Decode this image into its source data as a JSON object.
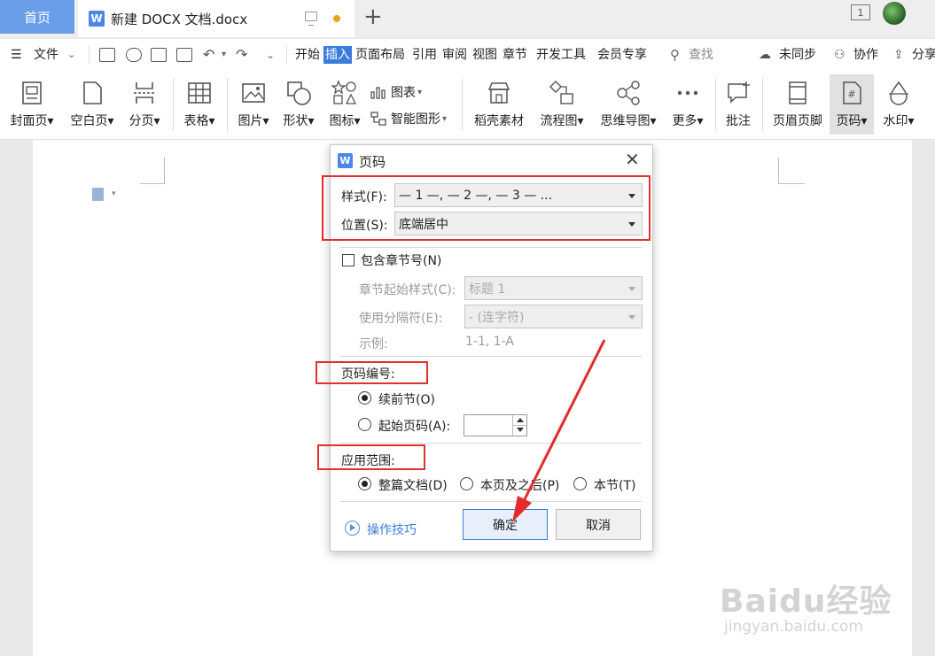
{
  "tabs": {
    "home": "首页",
    "doc_title": "新建 DOCX 文档.docx",
    "add": "+",
    "badge": "1"
  },
  "menubar": {
    "file": "文件",
    "items": [
      "开始",
      "插入",
      "页面布局",
      "引用",
      "审阅",
      "视图",
      "章节",
      "开发工具",
      "会员专享"
    ],
    "search": "查找",
    "sync": "未同步",
    "collab": "协作",
    "share": "分享"
  },
  "ribbon": {
    "cover": "封面页",
    "blank": "空白页",
    "break": "分页",
    "table": "表格",
    "picture": "图片",
    "shape": "形状",
    "icon": "图标",
    "chart": "图表",
    "smartart": "智能图形",
    "material": "稻壳素材",
    "flowchart": "流程图",
    "mindmap": "思维导图",
    "more": "更多",
    "comment": "批注",
    "header_footer": "页眉页脚",
    "page_number": "页码",
    "watermark": "水印"
  },
  "dialog": {
    "logo": "W",
    "title": "页码",
    "style_label": "样式(F):",
    "style_value": "— 1 —, — 2 —, — 3 — ...",
    "position_label": "位置(S):",
    "position_value": "底端居中",
    "include_chapter": "包含章节号(N)",
    "chapter_style_label": "章节起始样式(C):",
    "chapter_style_value": "标题 1",
    "separator_label": "使用分隔符(E):",
    "separator_value": "-    (连字符)",
    "example_label": "示例:",
    "example_value": "1-1, 1-A",
    "numbering_title": "页码编号:",
    "continue_prev": "续前节(O)",
    "start_at": "起始页码(A):",
    "scope_title": "应用范围:",
    "scope_whole": "整篇文档(D)",
    "scope_after": "本页及之后(P)",
    "scope_section": "本节(T)",
    "tips": "操作技巧",
    "ok": "确定",
    "cancel": "取消"
  },
  "watermark": {
    "brand": "Baidu经验",
    "url": "jingyan.baidu.com"
  },
  "colors": {
    "accent": "#3b7bdc",
    "home_tab": "#6a9de8",
    "annotation": "#e03030"
  }
}
